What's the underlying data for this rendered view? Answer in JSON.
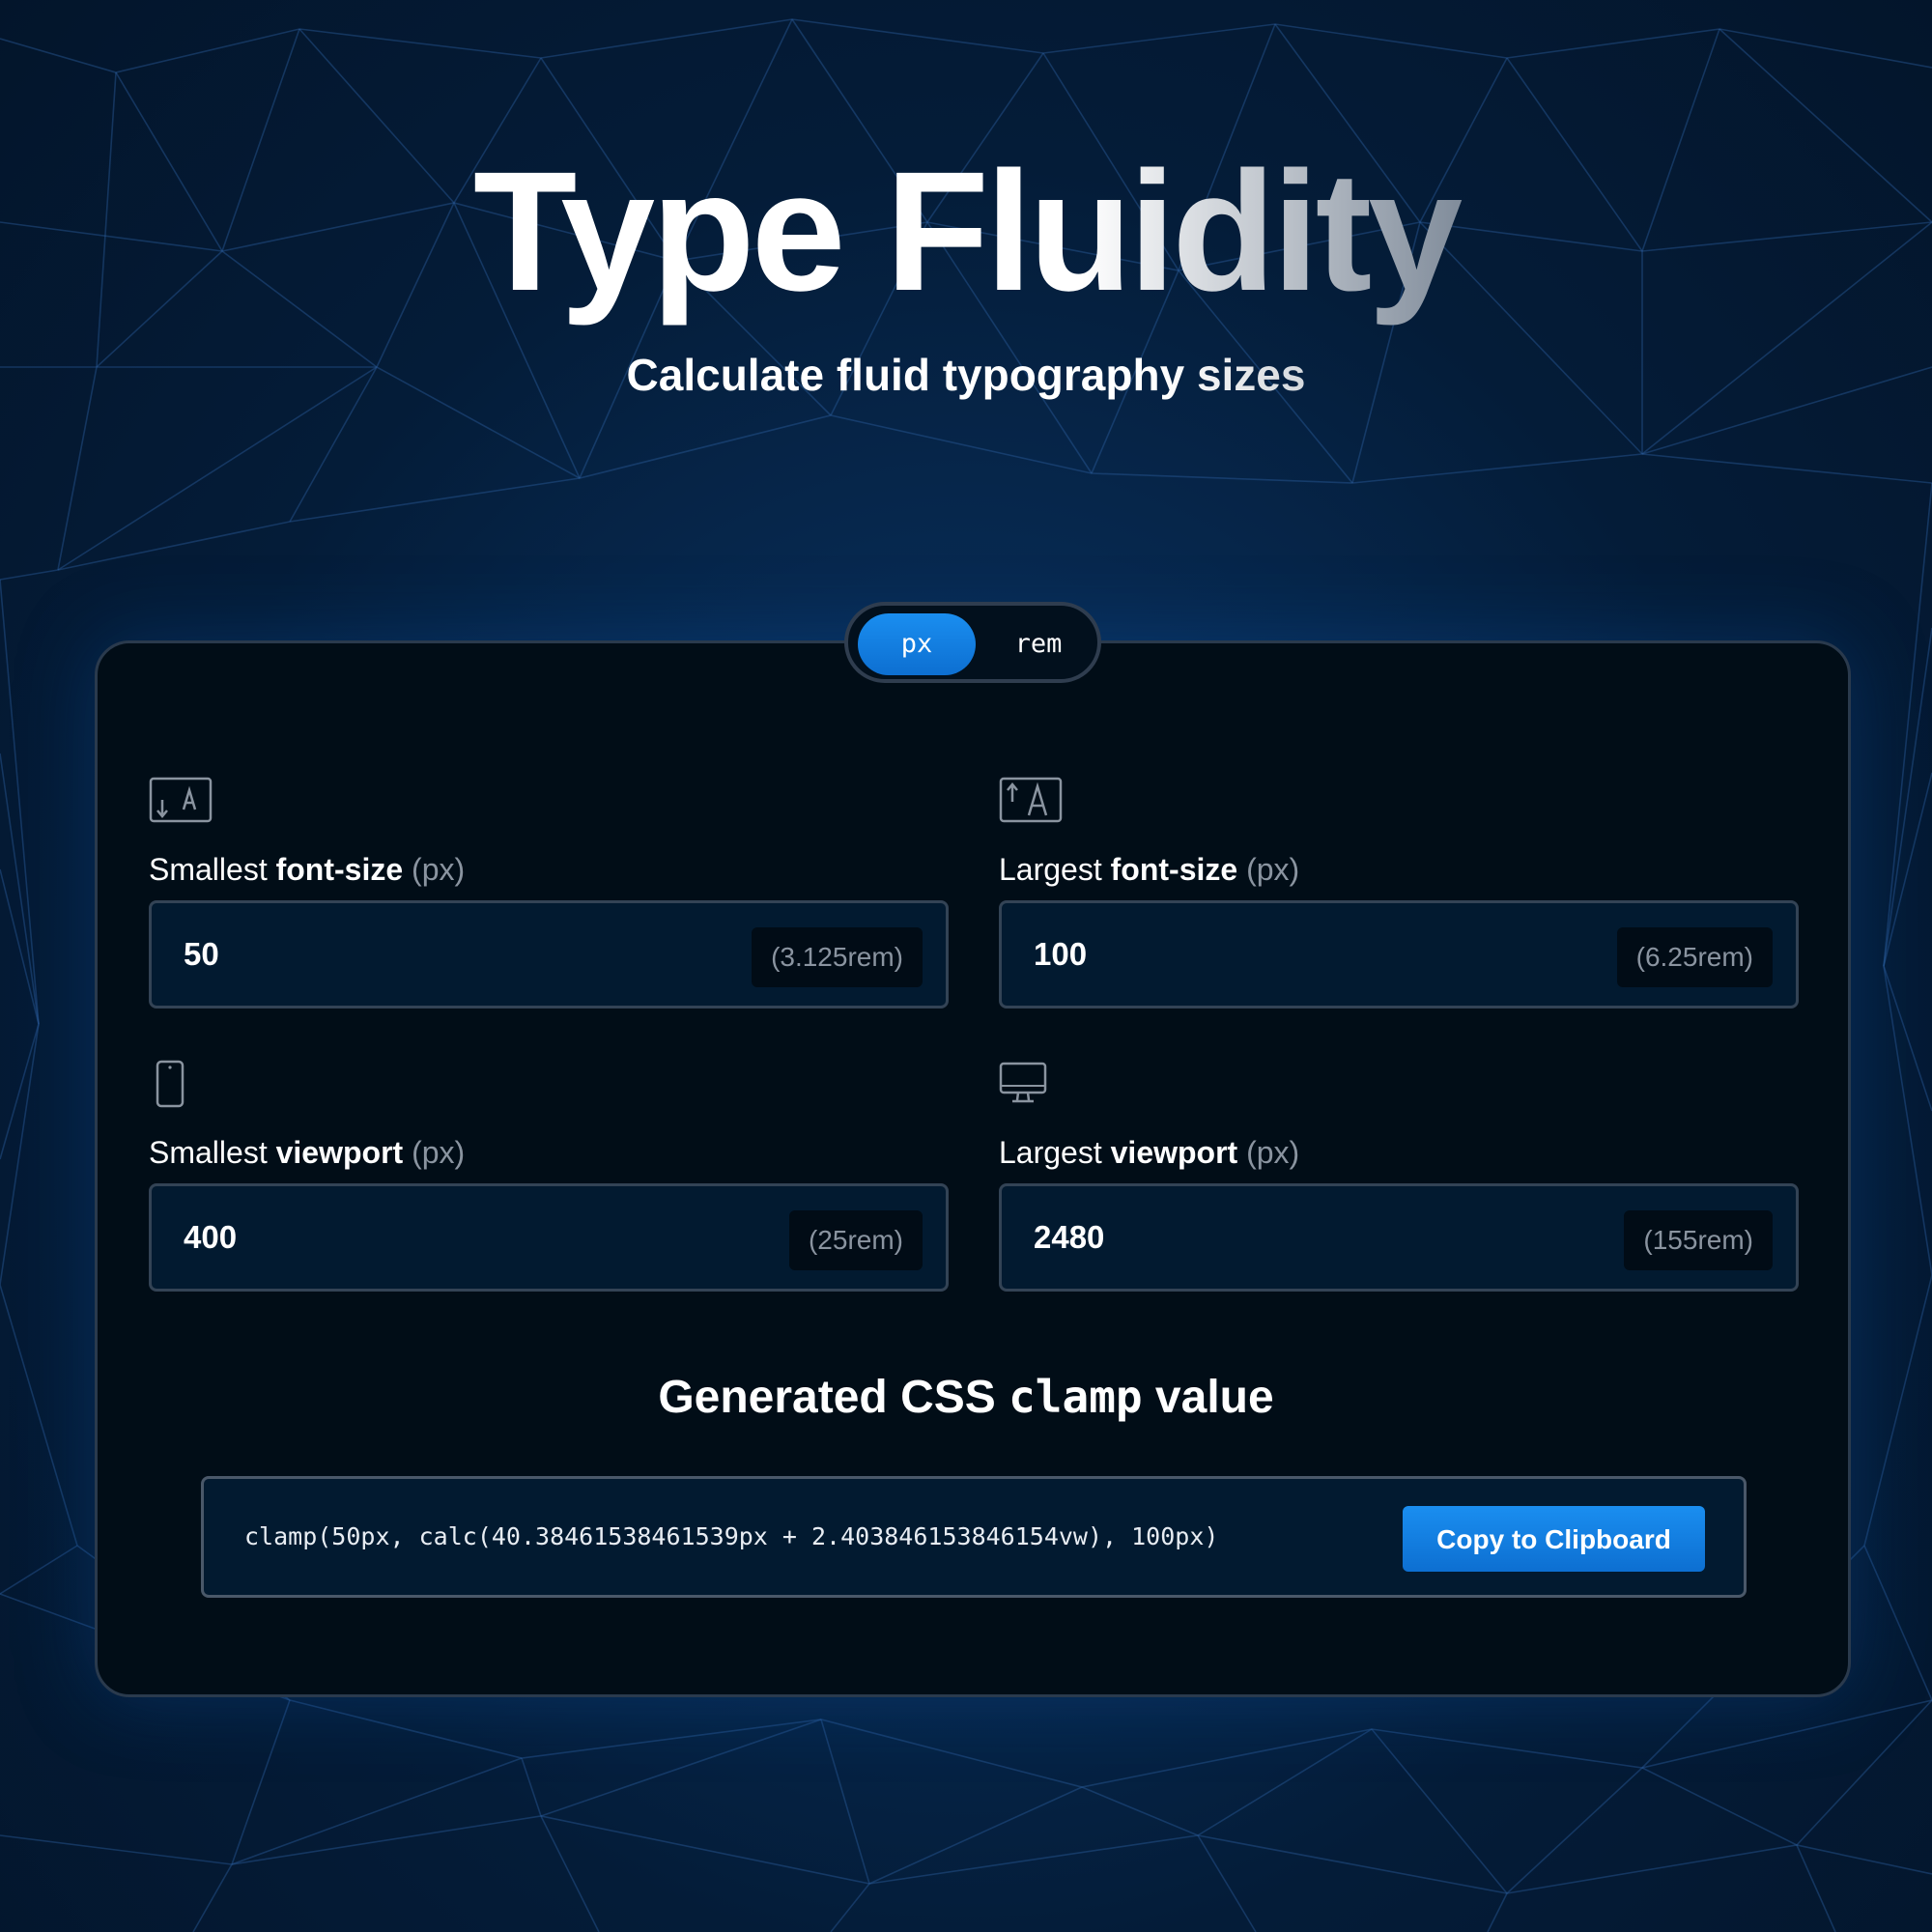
{
  "hero": {
    "title": "Type Fluidity",
    "subtitle": "Calculate fluid typography sizes"
  },
  "unit_toggle": {
    "options": [
      "px",
      "rem"
    ],
    "selected": "px"
  },
  "fields": {
    "min_font": {
      "label_prefix": "Smallest ",
      "label_bold": "font-size",
      "label_unit": " (px)",
      "value": "50",
      "converted": "(3.125rem)",
      "icon": "font-size-decrease-icon"
    },
    "max_font": {
      "label_prefix": "Largest ",
      "label_bold": "font-size",
      "label_unit": " (px)",
      "value": "100",
      "converted": "(6.25rem)",
      "icon": "font-size-increase-icon"
    },
    "min_viewport": {
      "label_prefix": "Smallest ",
      "label_bold": "viewport",
      "label_unit": " (px)",
      "value": "400",
      "converted": "(25rem)",
      "icon": "mobile-phone-icon"
    },
    "max_viewport": {
      "label_prefix": "Largest ",
      "label_bold": "viewport",
      "label_unit": " (px)",
      "value": "2480",
      "converted": "(155rem)",
      "icon": "desktop-monitor-icon"
    }
  },
  "result": {
    "heading_prefix": "Generated CSS ",
    "heading_code": "clamp",
    "heading_suffix": " value",
    "output": "clamp(50px, calc(40.38461538461539px + 2.403846153846154vw), 100px)",
    "copy_label": "Copy to Clipboard"
  },
  "colors": {
    "background": "#041c38",
    "panel": "#010d17",
    "input_bg": "#021a30",
    "accent": "#1584e8",
    "muted_text": "#8a94a0",
    "border": "#334355"
  }
}
